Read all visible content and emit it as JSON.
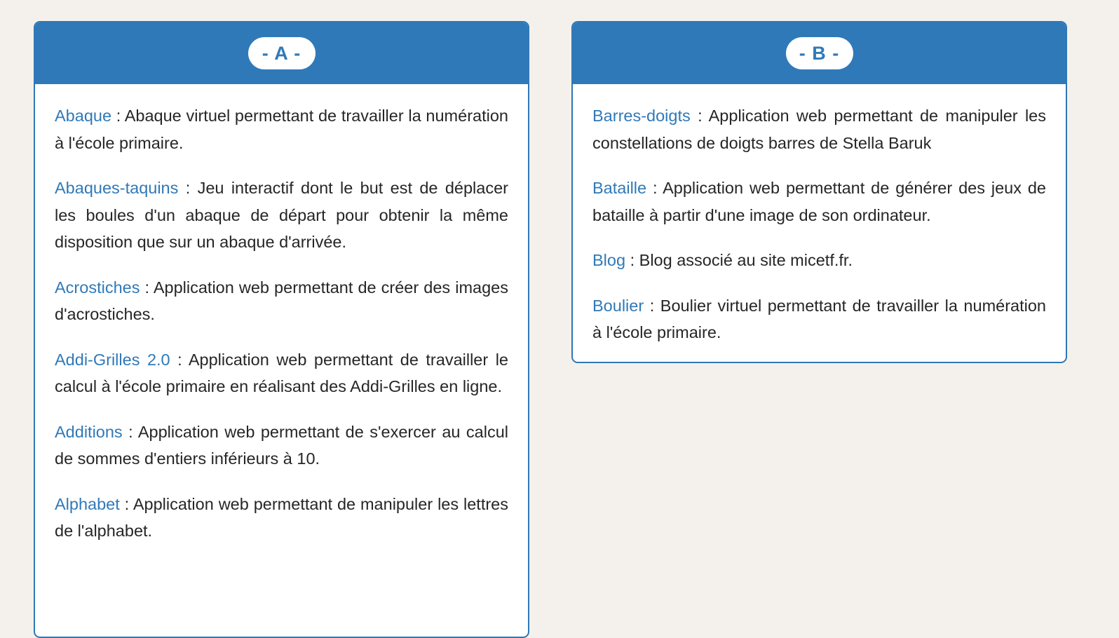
{
  "page": {
    "background_color": "#f4f1ec",
    "accent_color": "#3079b8",
    "link_color": "#3079b8",
    "text_color": "#262626",
    "card_background": "#ffffff"
  },
  "cards": [
    {
      "id": "card-a",
      "badge_label": "- A -",
      "entries": [
        {
          "name": "Abaque",
          "separator": " : ",
          "description": "Abaque virtuel permettant de travailler la numération à l'école primaire."
        },
        {
          "name": "Abaques-taquins",
          "separator": " : ",
          "description": "Jeu interactif dont le but est de déplacer les boules d'un abaque de départ pour obtenir la même disposition que sur un abaque d'arrivée."
        },
        {
          "name": "Acrostiches",
          "separator": " : ",
          "description": "Application web permettant de créer des images d'acrostiches."
        },
        {
          "name": "Addi-Grilles 2.0",
          "separator": " : ",
          "description": "Application web permettant de travailler le calcul à l'école primaire en réalisant des Addi-Grilles en ligne."
        },
        {
          "name": "Additions",
          "separator": " : ",
          "description": "Application web permettant de s'exercer au calcul de sommes d'entiers inférieurs à 10."
        },
        {
          "name": "Alphabet",
          "separator": " : ",
          "description": "Application web permettant de manipuler les lettres de l'alphabet."
        }
      ]
    },
    {
      "id": "card-b",
      "badge_label": "- B -",
      "entries": [
        {
          "name": "Barres-doigts",
          "separator": " : ",
          "description": "Application web permettant de manipuler les constellations de doigts barres de Stella Baruk"
        },
        {
          "name": "Bataille",
          "separator": " : ",
          "description": "Application web permettant de générer des jeux de bataille à partir d'une image de son ordinateur."
        },
        {
          "name": "Blog",
          "separator": " : ",
          "description": "Blog associé au site micetf.fr."
        },
        {
          "name": "Boulier",
          "separator": " : ",
          "description": "Boulier virtuel permettant de travailler la numération à l'école primaire."
        }
      ]
    }
  ]
}
